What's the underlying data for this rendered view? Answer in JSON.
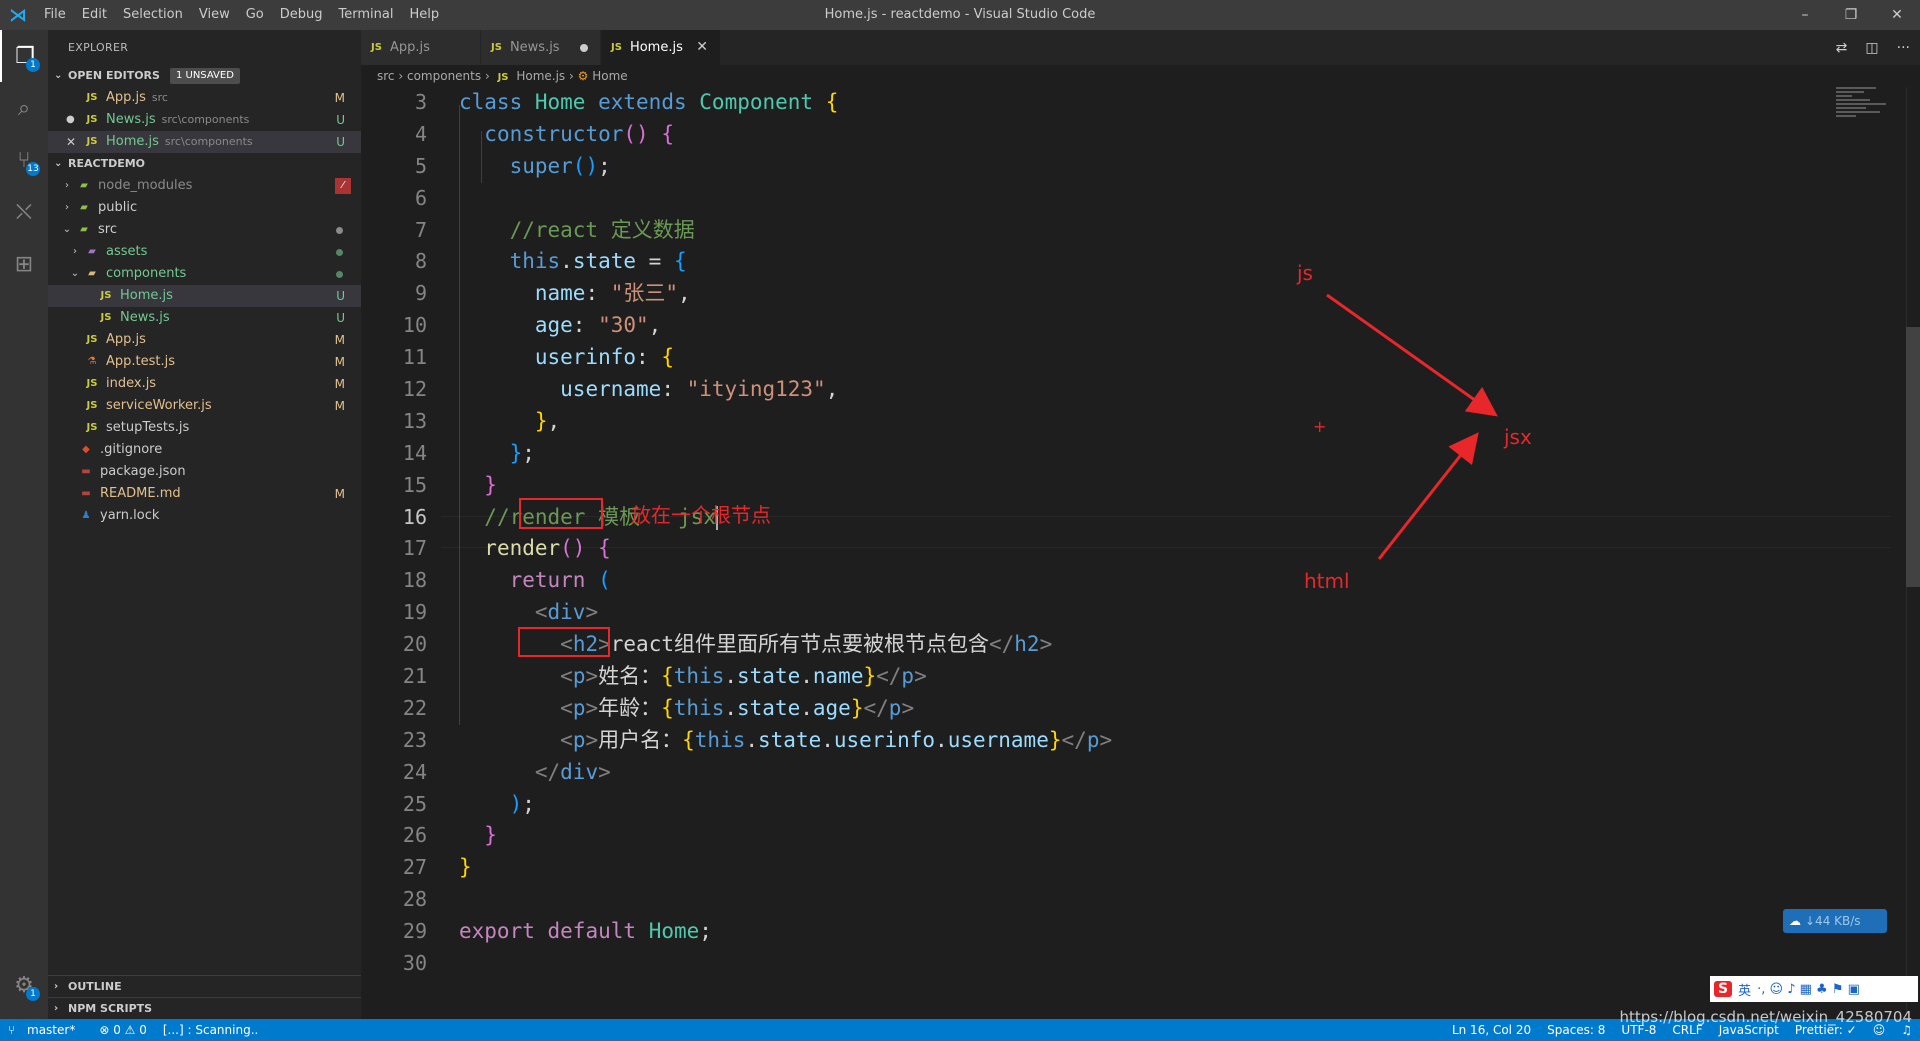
{
  "window": {
    "title": "Home.js - reactdemo - Visual Studio Code",
    "menu": [
      "File",
      "Edit",
      "Selection",
      "View",
      "Go",
      "Debug",
      "Terminal",
      "Help"
    ],
    "controls": [
      "–",
      "❐",
      "✕"
    ]
  },
  "activity": {
    "explorer_badge": "1",
    "scm_badge": "13",
    "settings_badge": "1"
  },
  "sidebar": {
    "title": "EXPLORER",
    "open_editors_label": "OPEN EDITORS",
    "unsaved_badge": "1 UNSAVED",
    "open_editors": [
      {
        "icon": "JS",
        "name": "App.js",
        "desc": "src",
        "status": "M"
      },
      {
        "icon": "JS",
        "name": "News.js",
        "desc": "src\\components",
        "status": "U"
      },
      {
        "icon": "JS",
        "name": "Home.js",
        "desc": "src\\components",
        "status": "U"
      }
    ],
    "project_label": "REACTDEMO",
    "tree": {
      "node_modules": "node_modules",
      "public": "public",
      "src": "src",
      "assets": "assets",
      "components": "components",
      "home": "Home.js",
      "home_status": "U",
      "news": "News.js",
      "news_status": "U",
      "app": "App.js",
      "app_status": "M",
      "apptest": "App.test.js",
      "apptest_status": "M",
      "index": "index.js",
      "index_status": "M",
      "sw": "serviceWorker.js",
      "sw_status": "M",
      "setup": "setupTests.js",
      "gitignore": ".gitignore",
      "package": "package.json",
      "readme": "README.md",
      "readme_status": "M",
      "yarn": "yarn.lock"
    },
    "outline_label": "OUTLINE",
    "npm_label": "NPM SCRIPTS"
  },
  "tabs": [
    {
      "icon": "JS",
      "label": "App.js"
    },
    {
      "icon": "JS",
      "label": "News.js"
    },
    {
      "icon": "JS",
      "label": "Home.js"
    }
  ],
  "breadcrumb": {
    "src": "src",
    "components": "components",
    "file": "Home.js",
    "symbol": "Home"
  },
  "editor": {
    "line_numbers": [
      "3",
      "4",
      "5",
      "6",
      "7",
      "8",
      "9",
      "10",
      "11",
      "12",
      "13",
      "14",
      "15",
      "16",
      "17",
      "18",
      "19",
      "20",
      "21",
      "22",
      "23",
      "24",
      "25",
      "26",
      "27",
      "28",
      "29",
      "30"
    ],
    "comment_react": "//react 定义数据",
    "comment_render": "//render 模板   jsx",
    "name_value": "\"张三\"",
    "age_value": "\"30\"",
    "username_value": "\"itying123\"",
    "h2_text": "react组件里面所有节点要被根节点包含",
    "p1_label": "姓名：",
    "p2_label": "年龄：",
    "p3_label": "用户名："
  },
  "annotations": {
    "root_note": "放在一个根节点",
    "js": "js",
    "jsx": "jsx",
    "html": "html",
    "plus": "+",
    "arrow_color": "#e8272b"
  },
  "overlays": {
    "speed": "↓44 KB/s",
    "ime_logo": "S",
    "ime_lang": "英",
    "ime_icons": "·, ☺ ♪ ▦ ♣ ⚑ ▣"
  },
  "statusbar": {
    "branch": "master*",
    "problems": "⊗ 0 ⚠ 0",
    "scanning": "[...] : Scanning..",
    "position": "Ln 16, Col 20",
    "spaces": "Spaces: 8",
    "encoding": "UTF-8",
    "eol": "CRLF",
    "language": "JavaScript",
    "prettier": "Prettier: ✓",
    "watermark": "https://blog.csdn.net/weixin_42580704"
  }
}
